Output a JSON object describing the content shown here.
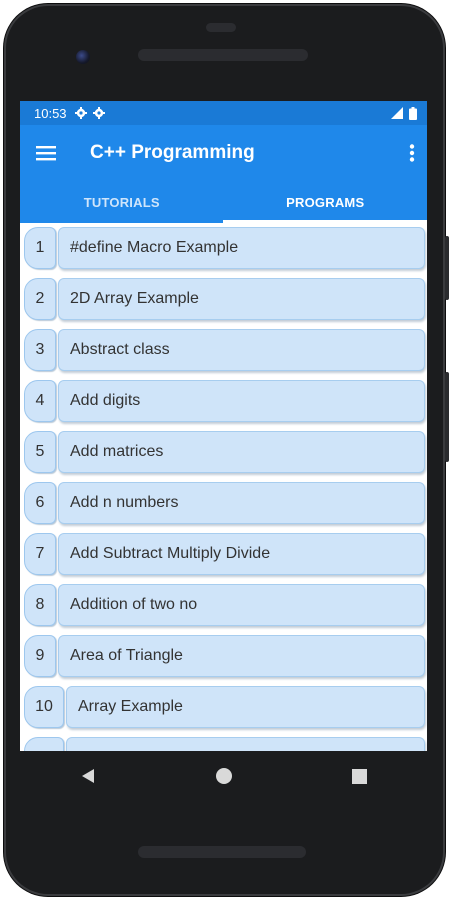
{
  "status_bar": {
    "time": "10:53",
    "left_icons": [
      "gear-icon",
      "gear-icon"
    ],
    "right_icons": [
      "signal-icon",
      "battery-icon"
    ]
  },
  "app_bar": {
    "title": "C++ Programming",
    "menu_icon": "hamburger-menu-icon",
    "overflow_icon": "more-vert-icon"
  },
  "tabs": [
    {
      "label": "TUTORIALS",
      "active": false
    },
    {
      "label": "PROGRAMS",
      "active": true
    }
  ],
  "programs": [
    {
      "num": "1",
      "title": "#define Macro Example"
    },
    {
      "num": "2",
      "title": "2D Array Example"
    },
    {
      "num": "3",
      "title": "Abstract class"
    },
    {
      "num": "4",
      "title": "Add digits"
    },
    {
      "num": "5",
      "title": "Add matrices"
    },
    {
      "num": "6",
      "title": "Add n numbers"
    },
    {
      "num": "7",
      "title": "Add Subtract Multiply Divide"
    },
    {
      "num": "8",
      "title": "Addition of two no"
    },
    {
      "num": "9",
      "title": "Area of Triangle"
    },
    {
      "num": "10",
      "title": "Array Example"
    }
  ],
  "nav_bar": {
    "back_icon": "back-triangle-icon",
    "home_icon": "home-circle-icon",
    "recents_icon": "recents-square-icon"
  },
  "colors": {
    "status_bar": "#1a7ad6",
    "app_bar": "#1f88ea",
    "item_fill": "#cfe4f9",
    "item_border": "#a7cdef",
    "frame": "#1b1c1e"
  }
}
